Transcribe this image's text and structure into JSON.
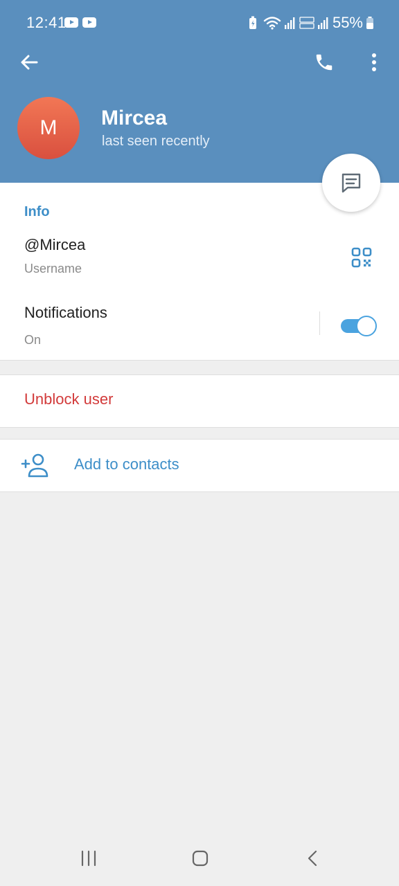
{
  "status_bar": {
    "time": "12:41",
    "battery_percent": "55%",
    "notification_icons": [
      "youtube-icon",
      "youtube-icon"
    ],
    "system_icons": [
      "battery-saver-icon",
      "wifi-icon",
      "signal-icon",
      "volte-lte2-icon",
      "signal-icon",
      "battery-icon"
    ]
  },
  "header": {
    "avatar_letter": "M",
    "name": "Mircea",
    "status": "last seen recently",
    "back_icon": "arrow-left-icon",
    "call_icon": "phone-icon",
    "more_icon": "more-vertical-icon",
    "message_icon": "message-icon"
  },
  "info": {
    "title": "Info",
    "username": "@Mircea",
    "username_label": "Username",
    "qr_icon": "qr-code-icon",
    "notifications_label": "Notifications",
    "notifications_value": "On",
    "notifications_enabled": true
  },
  "actions": {
    "unblock": "Unblock user",
    "add_contact": "Add to contacts",
    "add_contact_icon": "add-person-icon"
  },
  "nav": {
    "icons": [
      "recent-apps-icon",
      "home-icon",
      "back-icon"
    ]
  },
  "colors": {
    "header_bg": "#5a8fbe",
    "accent": "#3d8ec8",
    "danger": "#d23a3a",
    "avatar": "#e6634a",
    "toggle": "#4aa3df",
    "background": "#efefef"
  }
}
